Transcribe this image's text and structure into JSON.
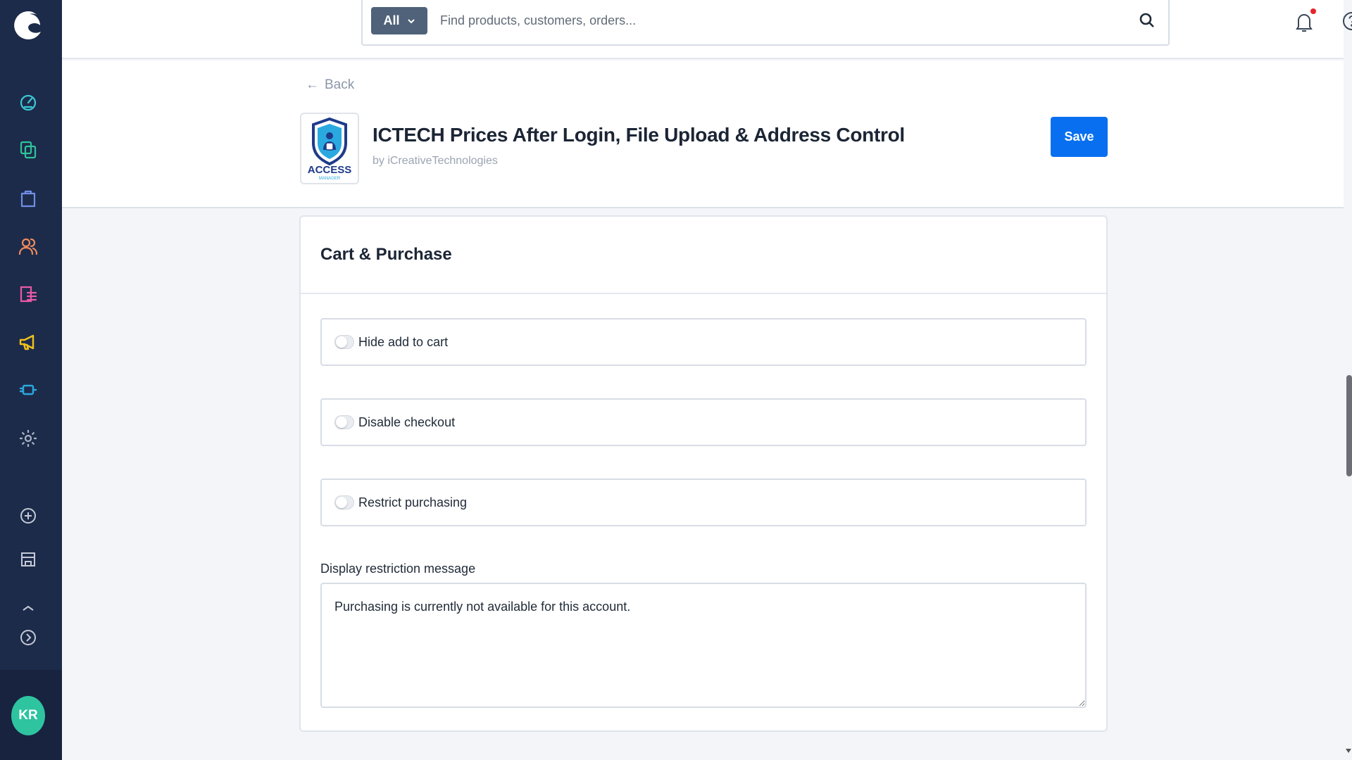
{
  "sidebar": {
    "nav": [
      {
        "name": "dashboard-icon",
        "color": "#3bc9d6"
      },
      {
        "name": "catalog-icon",
        "color": "#2ec49a"
      },
      {
        "name": "orders-icon",
        "color": "#6f8fe6"
      },
      {
        "name": "customers-icon",
        "color": "#f08a5d"
      },
      {
        "name": "content-icon",
        "color": "#e95aa6"
      },
      {
        "name": "marketing-icon",
        "color": "#f2c21b"
      },
      {
        "name": "extensions-icon",
        "color": "#2aa9e0"
      },
      {
        "name": "settings-icon",
        "color": "#a8b3c4"
      }
    ],
    "avatar_initials": "KR"
  },
  "search": {
    "scope": "All",
    "placeholder": "Find products, customers, orders..."
  },
  "header": {
    "back_label": "Back",
    "app_title": "ICTECH Prices After Login, File Upload & Address Control",
    "app_vendor": "by iCreativeTechnologies",
    "save_label": "Save",
    "logo_text": "ACCESS",
    "logo_subtext": "MANAGER"
  },
  "card": {
    "title": "Cart & Purchase",
    "toggles": [
      {
        "label": "Hide add to cart",
        "checked": false
      },
      {
        "label": "Disable checkout",
        "checked": false
      },
      {
        "label": "Restrict purchasing",
        "checked": false
      }
    ],
    "message_label": "Display restriction message",
    "message_value": "Purchasing is currently not available for this account."
  },
  "colors": {
    "accent": "#0870f0",
    "sidebar": "#1d2b4a"
  }
}
